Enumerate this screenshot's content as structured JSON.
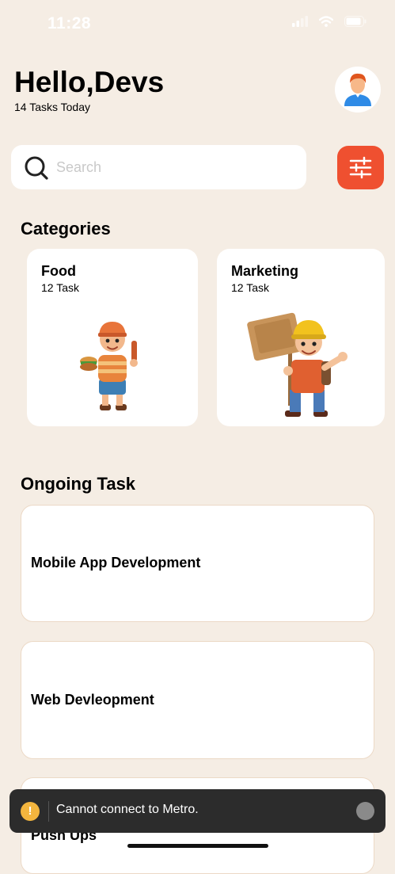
{
  "status_bar": {
    "time": "11:28"
  },
  "header": {
    "greeting": "Hello,Devs",
    "subtitle": "14 Tasks Today"
  },
  "search": {
    "placeholder": "Search",
    "value": ""
  },
  "categories": {
    "title": "Categories",
    "items": [
      {
        "name": "Food",
        "count": "12 Task"
      },
      {
        "name": "Marketing",
        "count": "12 Task"
      }
    ]
  },
  "ongoing": {
    "title": "Ongoing Task",
    "items": [
      {
        "name": "Mobile App Development"
      },
      {
        "name": "Web Devleopment"
      },
      {
        "name": "Push Ups"
      }
    ]
  },
  "toast": {
    "message": "Cannot connect to Metro.",
    "icon_glyph": "!"
  },
  "colors": {
    "background": "#f5ede4",
    "accent": "#ef5030",
    "toast_bg": "#2c2c2c",
    "warning": "#f3b53e"
  }
}
